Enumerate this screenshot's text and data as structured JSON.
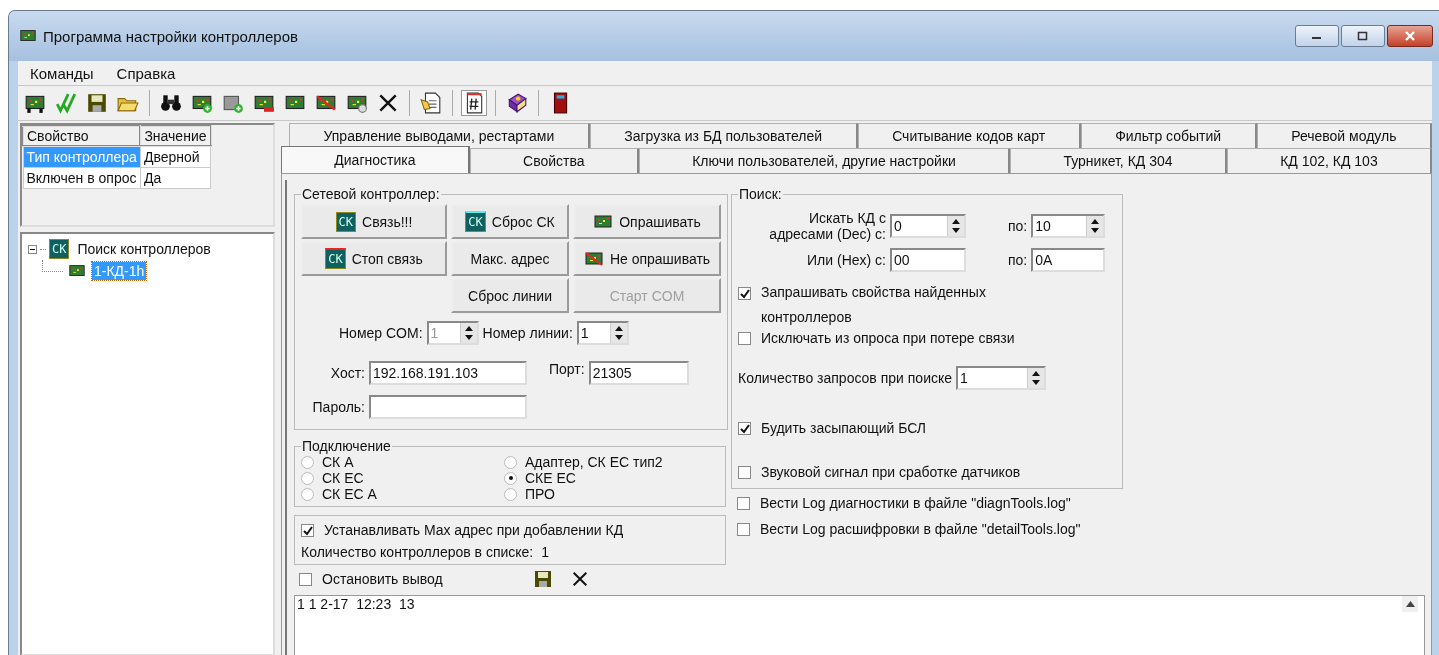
{
  "window": {
    "title": "Программа настройки контроллеров"
  },
  "menu": [
    {
      "label": "Команды"
    },
    {
      "label": "Справка"
    }
  ],
  "toolbar": [
    {
      "kind": "board-stand",
      "pressed": false
    },
    {
      "kind": "check",
      "pressed": false
    },
    {
      "kind": "save",
      "pressed": false
    },
    {
      "kind": "open",
      "pressed": false
    },
    {
      "kind": "sep"
    },
    {
      "kind": "binoculars",
      "pressed": false
    },
    {
      "kind": "board-add",
      "pressed": false
    },
    {
      "kind": "grey-add",
      "pressed": false
    },
    {
      "kind": "board-remove",
      "pressed": false
    },
    {
      "kind": "board",
      "pressed": false
    },
    {
      "kind": "board-crossed",
      "pressed": false
    },
    {
      "kind": "board-gear",
      "pressed": false
    },
    {
      "kind": "cross",
      "pressed": false
    },
    {
      "kind": "sep"
    },
    {
      "kind": "notes",
      "pressed": false
    },
    {
      "kind": "sep"
    },
    {
      "kind": "hash",
      "pressed": true
    },
    {
      "kind": "sep"
    },
    {
      "kind": "book",
      "pressed": false
    },
    {
      "kind": "sep"
    },
    {
      "kind": "door",
      "pressed": false
    }
  ],
  "properties": {
    "columns": [
      "Свойство",
      "Значение"
    ],
    "rows": [
      {
        "cells": [
          "Тип контроллера",
          "Дверной"
        ],
        "selected": true
      },
      {
        "cells": [
          "Включен в опрос",
          "Да"
        ],
        "selected": false
      }
    ]
  },
  "tree": [
    {
      "label": "Поиск контроллеров",
      "badge": "СК",
      "expanded": true,
      "selected": false,
      "children": [
        {
          "label": "1-КД-1h",
          "selected": true
        }
      ]
    }
  ],
  "tabs": {
    "back_row": [
      {
        "label": "Управление выводами, рестартами",
        "selected": false
      },
      {
        "label": "Загрузка из БД пользователей",
        "selected": false
      },
      {
        "label": "Считывание кодов карт",
        "selected": false
      },
      {
        "label": "Фильтр событий",
        "selected": false
      },
      {
        "label": "Речевой модуль",
        "selected": false
      }
    ],
    "front_row": [
      {
        "label": "Диагностика",
        "selected": true
      },
      {
        "label": "Свойства",
        "selected": false
      },
      {
        "label": "Ключи пользователей, другие настройки",
        "selected": false
      },
      {
        "label": "Турникет, КД 304",
        "selected": false
      },
      {
        "label": "КД 102, КД 103",
        "selected": false
      }
    ]
  },
  "network": {
    "title": "Сетевой контроллер:",
    "buttons": [
      {
        "label": "Связь!!!",
        "kind": "ck",
        "badge": "СК",
        "disabled": false
      },
      {
        "label": "Сброс СК",
        "kind": "ck-reset",
        "badge": "СК",
        "disabled": false
      },
      {
        "label": "Опрашивать",
        "kind": "board",
        "disabled": false
      },
      {
        "label": "Стоп связь",
        "kind": "ck-stop",
        "badge": "СК",
        "disabled": false
      },
      {
        "label": "Макс. адрес",
        "disabled": false
      },
      {
        "label": "Не опрашивать",
        "kind": "board-crossed",
        "disabled": false
      },
      {
        "label": "Сброс линии",
        "disabled": false
      },
      {
        "label": "Старт COM",
        "disabled": true
      }
    ],
    "com": {
      "label": "Номер COM:",
      "value": "1",
      "disabled": true
    },
    "line": {
      "label": "Номер линии:",
      "value": "1",
      "disabled": false
    },
    "host": {
      "label": "Хост:",
      "value": "192.168.191.103"
    },
    "port": {
      "label": "Порт:",
      "value": "21305"
    },
    "password": {
      "label": "Пароль:"
    }
  },
  "connection": {
    "title": "Подключение",
    "options": [
      {
        "label": "СК А",
        "selected": false
      },
      {
        "label": "СК ЕС",
        "selected": false
      },
      {
        "label": "СК ЕС А",
        "selected": false
      },
      {
        "label": "Адаптер, СК ЕС тип2",
        "selected": false
      },
      {
        "label": "СКЕ ЕС",
        "selected": true
      },
      {
        "label": "ПРО",
        "selected": false
      }
    ]
  },
  "max_address": {
    "label": "Устанавливать Max адрес при добавлении КД",
    "checked": true
  },
  "controller_count": {
    "label": "Количество контроллеров в списке:",
    "value": "1"
  },
  "stop_output": {
    "label": "Остановить вывод",
    "checked": false
  },
  "search": {
    "title": "Поиск:",
    "dec_label": "Искать КД с адресами (Dec) с:",
    "dec_from": "0",
    "dec_to_label": "по:",
    "dec_to": "10",
    "hex_label": "Или (Hex) с:",
    "hex_from": "00",
    "hex_to_label": "по:",
    "hex_to": "0A",
    "items": [
      {
        "kind": "checkbox",
        "label": "Запрашивать свойства найденных контроллеров",
        "checked": true
      },
      {
        "kind": "checkbox",
        "label": "Исключать из опроса при потере связи",
        "checked": false
      },
      {
        "kind": "spin",
        "label": "Количество запросов при поиске",
        "value": "1"
      },
      {
        "kind": "checkbox",
        "label": "Будить засыпающий БСЛ",
        "checked": true
      },
      {
        "kind": "checkbox",
        "label": "Звуковой сигнал при сработке датчиков",
        "checked": false
      }
    ]
  },
  "log_options": [
    {
      "label": "Вести Log диагностики в файле \"diagnTools.log\"",
      "checked": false
    },
    {
      "label": "Вести Log расшифровки в файле \"detailTools.log\"",
      "checked": false
    }
  ],
  "log": {
    "lines": [
      "1 1 2-17  12:23  13"
    ]
  }
}
